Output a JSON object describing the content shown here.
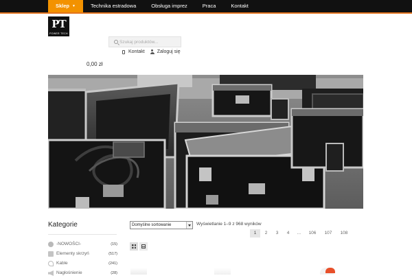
{
  "nav": {
    "items": [
      {
        "label": "Sklep",
        "active": true,
        "has_dropdown": true
      },
      {
        "label": "Technika estradowa",
        "active": false
      },
      {
        "label": "Obsługa imprez",
        "active": false
      },
      {
        "label": "Praca",
        "active": false
      },
      {
        "label": "Kontakt",
        "active": false
      }
    ]
  },
  "logo": {
    "letters": "PT",
    "subtitle": "POWER TECH"
  },
  "search": {
    "placeholder": "Szukaj produktów..."
  },
  "user_links": {
    "contact": "Kontakt",
    "login": "Zaloguj się"
  },
  "cart": {
    "total": "0,00 zł"
  },
  "sidebar": {
    "title": "Kategorie",
    "categories": [
      {
        "label": "-NOWOŚCI-",
        "count": "(15)",
        "icon": "badge-icon"
      },
      {
        "label": "Elementy skrzyń",
        "count": "(517)",
        "icon": "box-parts-icon"
      },
      {
        "label": "Kable",
        "count": "(241)",
        "icon": "cable-icon"
      },
      {
        "label": "Nagłośnienie",
        "count": "(28)",
        "icon": "speaker-icon"
      }
    ]
  },
  "toolbar": {
    "sort_value": "Domyślne sortowanie",
    "results_text": "Wyświetlanie 1–9 z 968 wyników"
  },
  "pagination": {
    "pages": [
      "1",
      "2",
      "3",
      "4",
      "...",
      "106",
      "107",
      "108"
    ],
    "current": "1"
  },
  "view_modes": [
    "grid",
    "list"
  ],
  "colors": {
    "accent": "#f39200",
    "topbar": "#111111",
    "accent_line": "#e2731e"
  }
}
